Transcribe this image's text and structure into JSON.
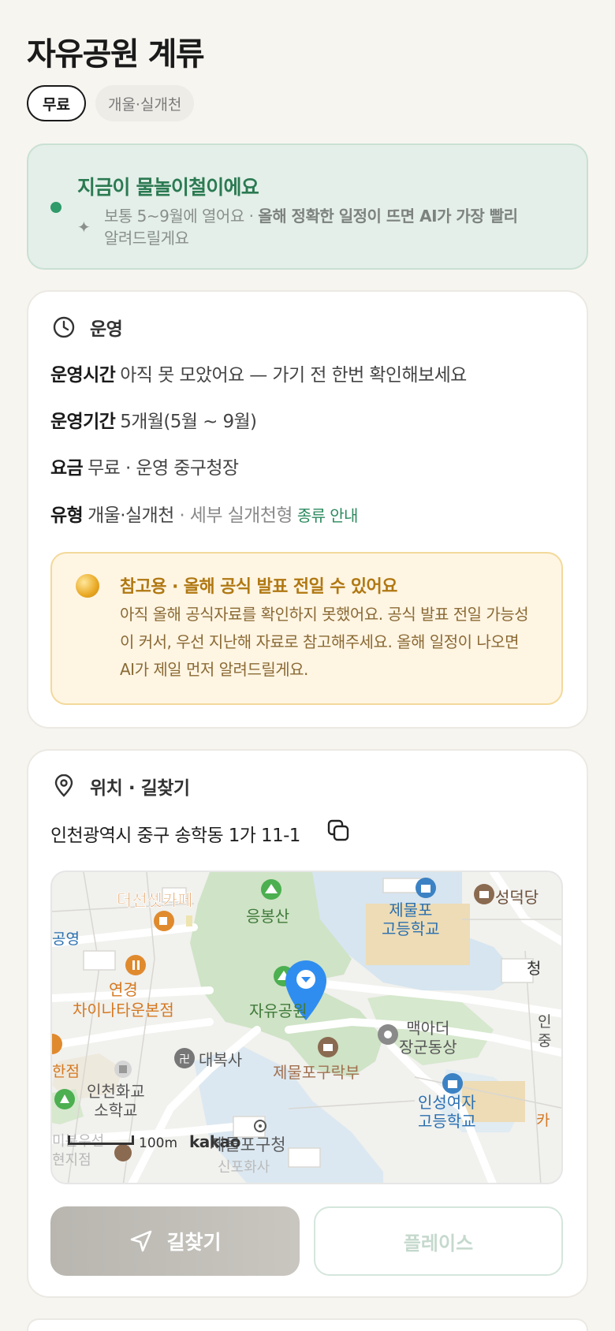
{
  "header": {
    "title": "자유공원 계류"
  },
  "chips": [
    {
      "label": "무료"
    },
    {
      "label": "개울·실개천"
    }
  ],
  "season": {
    "headline": "지금이 물놀이철이에요",
    "sub_plain": "보통 5~9월에 열어요 · ",
    "sub_bold": "올해 정확한 일정이 뜨면 AI가 가장 빨리",
    "sub_tail": "알려드릴게요",
    "accent_color": "#2b7a52"
  },
  "operation": {
    "section_label": "운영",
    "hours_key": "운영시간",
    "hours_value": "아직 못 모았어요 — 가기 전 한번 확인해보세요",
    "period_key": "운영기간",
    "period_value": "5개월(5월 ~ 9월)",
    "fee_key": "요금",
    "fee_value": "무료 · 운영 중구청장",
    "type_key": "유형",
    "type_value": "개울·실개천",
    "type_detail": " · 세부 실개천형",
    "type_link": "종류 안내",
    "notice": {
      "title": "참고용 · 올해 공식 발표 전일 수 있어요",
      "body": "아직 올해 공식자료를 확인하지 못했어요. 공식 발표 전일 가능성이 커서, 우선 지난해 자료로 참고해주세요. 올해 일정이 나오면 AI가 제일 먼저 알려드릴게요."
    }
  },
  "location": {
    "section_label": "위치 · 길찾기",
    "address": "인천광역시 중구 송학동 1가 11-1",
    "map": {
      "labels": {
        "cafe": "더선셋카페",
        "mountain": "응봉산",
        "school1a": "제물포",
        "school1b": "고등학교",
        "seongdeok": "성덕당",
        "gongyeong": "공영",
        "restaurant_a": "연경",
        "restaurant_b": "차이나타운본점",
        "park": "자유공원",
        "statue_a": "맥아더",
        "statue_b": "장군동상",
        "daeboksa": "대복사",
        "club": "제물포구락부",
        "hanjeom": "한점",
        "school2a": "인천화교",
        "school2b": "소학교",
        "school3a": "인성여자",
        "school3b": "고등학교",
        "cheong": "청",
        "in_jung": "인",
        "jung": "중",
        "ka": "카",
        "scale": "100m",
        "kakao": "kakao",
        "gucheong": "제물포구청",
        "bottom_left_a": "미분우선",
        "bottom_left_b": "현지점",
        "bottom_mid": "신포화사"
      }
    },
    "nav_button": "길찾기",
    "place_button": "플레이스"
  }
}
